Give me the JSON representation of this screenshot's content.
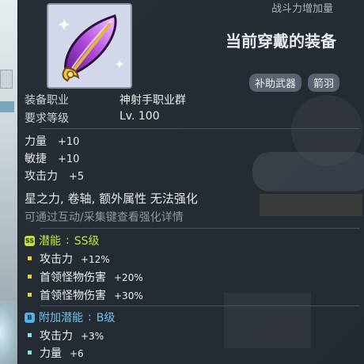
{
  "header_note": "战斗力增加量",
  "equip_title": "当前穿戴的装备",
  "tags": [
    "补助武器",
    "箭羽"
  ],
  "info": {
    "job_label": "装备职业",
    "job_value": "神射手职业群",
    "level_label": "要求等级",
    "level_value": "Lv.  100"
  },
  "stats": [
    {
      "name": "力量",
      "value": "+10"
    },
    {
      "name": "敏捷",
      "value": "+10"
    },
    {
      "name": "攻击力",
      "value": "+5"
    }
  ],
  "star_line": "星之力, 卷轴, 额外属性 无法强化",
  "hint_line": "可通过互动/采集键查看强化详情",
  "potential": {
    "title": "潜能",
    "grade": "SS级",
    "badge": "SS",
    "lines": [
      {
        "name": "攻击力",
        "value": "+12%"
      },
      {
        "name": "首领怪物伤害",
        "value": "+20%"
      },
      {
        "name": "首领怪物伤害",
        "value": "+30%"
      }
    ]
  },
  "additional_potential": {
    "title": "附加潜能",
    "grade": "B级",
    "badge": "B",
    "lines": [
      {
        "name": "攻击力",
        "value": "+3%"
      },
      {
        "name": "力量",
        "value": "+6"
      }
    ]
  },
  "colors": {
    "potential_accent": "#c8e23c",
    "additional_accent": "#4fb3e8"
  },
  "icon": "purple-quiver-feather-icon"
}
